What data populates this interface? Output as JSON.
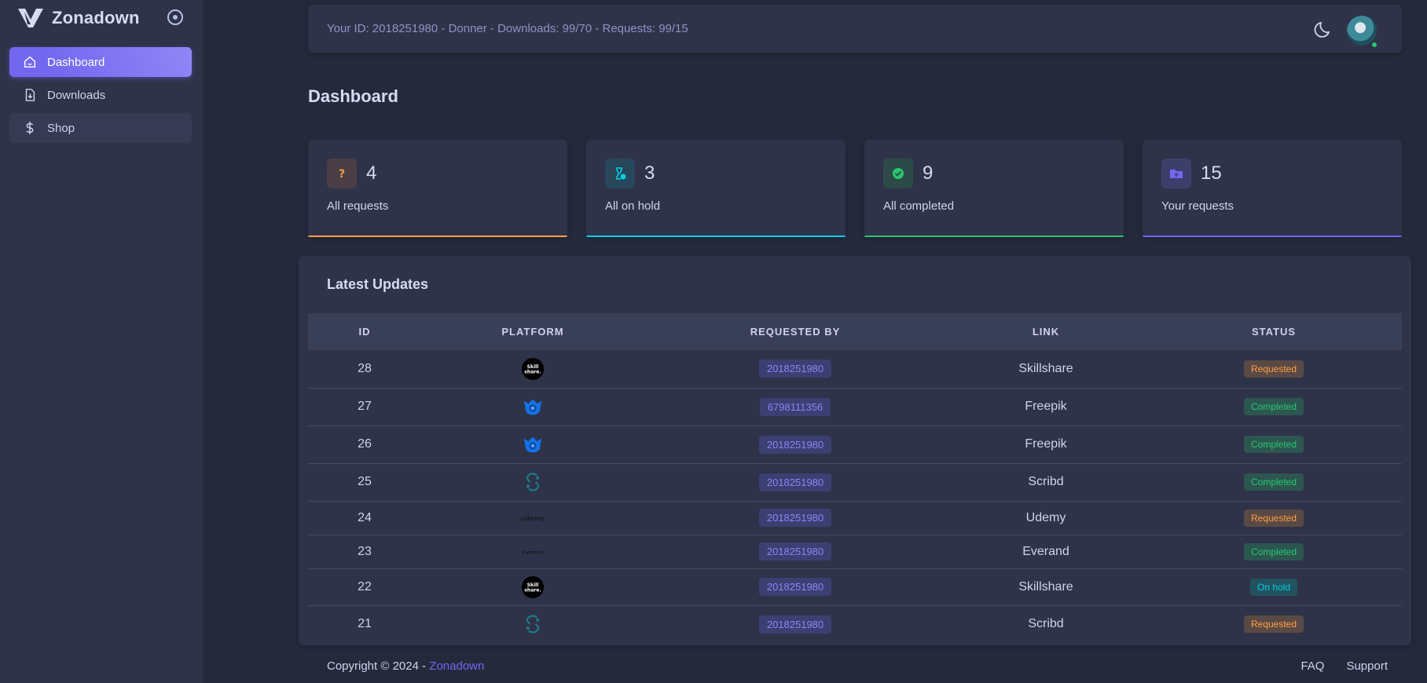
{
  "brand": {
    "name": "Zonadown"
  },
  "sidebar": {
    "items": [
      {
        "label": "Dashboard",
        "icon": "home-icon"
      },
      {
        "label": "Downloads",
        "icon": "download-file-icon"
      },
      {
        "label": "Shop",
        "icon": "dollar-icon"
      }
    ]
  },
  "topbar": {
    "info": "Your ID: 2018251980 - Donner - Downloads: 99/70 - Requests: 99/15"
  },
  "page": {
    "title": "Dashboard"
  },
  "cards": [
    {
      "value": "4",
      "label": "All requests",
      "icon": "question-icon",
      "color": "#ff9f43"
    },
    {
      "value": "3",
      "label": "All on hold",
      "icon": "hourglass-icon",
      "color": "#00cfe8"
    },
    {
      "value": "9",
      "label": "All completed",
      "icon": "check-circle-icon",
      "color": "#28c76f"
    },
    {
      "value": "15",
      "label": "Your requests",
      "icon": "folder-icon",
      "color": "#7367f0"
    }
  ],
  "updates": {
    "title": "Latest Updates",
    "columns": [
      "ID",
      "PLATFORM",
      "REQUESTED BY",
      "LINK",
      "STATUS"
    ],
    "rows": [
      {
        "id": "28",
        "platform": "skillshare-logo",
        "requested_by": "2018251980",
        "link": "Skillshare",
        "status": "Requested"
      },
      {
        "id": "27",
        "platform": "freepik-logo",
        "requested_by": "6798111356",
        "link": "Freepik",
        "status": "Completed"
      },
      {
        "id": "26",
        "platform": "freepik-logo",
        "requested_by": "2018251980",
        "link": "Freepik",
        "status": "Completed"
      },
      {
        "id": "25",
        "platform": "scribd-logo",
        "requested_by": "2018251980",
        "link": "Scribd",
        "status": "Completed"
      },
      {
        "id": "24",
        "platform": "udemy-logo",
        "requested_by": "2018251980",
        "link": "Udemy",
        "status": "Requested"
      },
      {
        "id": "23",
        "platform": "everand-logo",
        "requested_by": "2018251980",
        "link": "Everand",
        "status": "Completed"
      },
      {
        "id": "22",
        "platform": "skillshare-logo",
        "requested_by": "2018251980",
        "link": "Skillshare",
        "status": "On hold"
      },
      {
        "id": "21",
        "platform": "scribd-logo",
        "requested_by": "2018251980",
        "link": "Scribd",
        "status": "Requested"
      }
    ]
  },
  "footer": {
    "copyright": "Copyright © 2024 - ",
    "brand": "Zonadown",
    "links": [
      "FAQ",
      "Support"
    ]
  },
  "colors": {
    "accent": "#7367f0",
    "warning": "#ff9f43",
    "info": "#00cfe8",
    "success": "#28c76f"
  }
}
